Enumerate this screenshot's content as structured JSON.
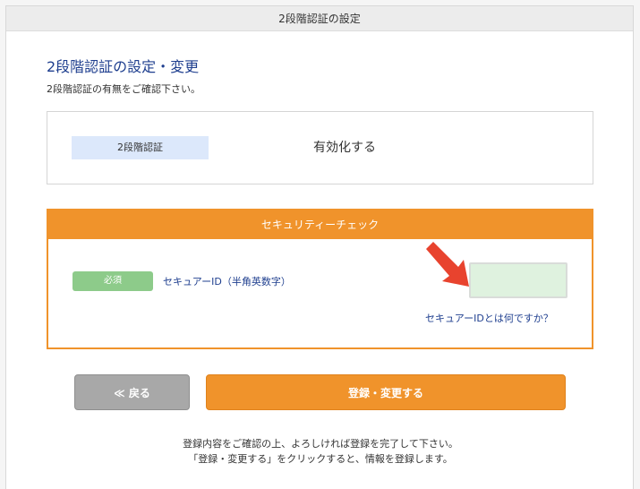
{
  "window": {
    "title": "2段階認証の設定"
  },
  "page": {
    "heading": "2段階認証の設定・変更",
    "subtext": "2段階認証の有無をご確認下さい。"
  },
  "two_factor": {
    "label": "2段階認証",
    "value": "有効化する"
  },
  "security_check": {
    "header": "セキュリティーチェック",
    "required_badge": "必須",
    "field_label": "セキュアーID（半角英数字）",
    "input_value": "",
    "help_link": "セキュアーIDとは何ですか？"
  },
  "buttons": {
    "back_label": "≪ 戻る",
    "submit_label": "登録・変更する"
  },
  "footnote": {
    "line1": "登録内容をご確認の上、よろしければ登録を完了して下さい。",
    "line2": "「登録・変更する」をクリックすると、情報を登録します。"
  },
  "colors": {
    "accent_orange": "#f0932b",
    "link_blue": "#1f3f8f",
    "required_green": "#8dcb8a",
    "arrow_red": "#e8432e"
  },
  "icons": {
    "annotation_arrow": "red-arrow-icon"
  }
}
